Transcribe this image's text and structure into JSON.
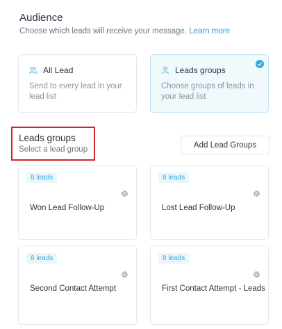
{
  "audience": {
    "title": "Audience",
    "subtitle": "Choose which leads will receive your message.",
    "learn_more": "Learn more"
  },
  "options": [
    {
      "icon": "users-icon",
      "title": "All Lead",
      "description": "Send to every lead in your lead list",
      "selected": false
    },
    {
      "icon": "user-icon",
      "title": "Leads groups",
      "description": "Choose groups of leads in your lead list",
      "selected": true
    }
  ],
  "leads_groups": {
    "title": "Leads groups",
    "subtitle": "Select a lead group",
    "add_button": "Add Lead Groups",
    "groups": [
      {
        "badge": "8 leads",
        "name": "Won Lead Follow-Up"
      },
      {
        "badge": "8 leads",
        "name": "Lost Lead Follow-Up"
      },
      {
        "badge": "8 leads",
        "name": "Second Contact Attempt"
      },
      {
        "badge": "8 leads",
        "name": "First Contact Attempt - Leads"
      }
    ]
  },
  "colors": {
    "accent": "#38a9dd",
    "highlight": "#d4232b",
    "selected_bg": "#f2f9fd"
  }
}
